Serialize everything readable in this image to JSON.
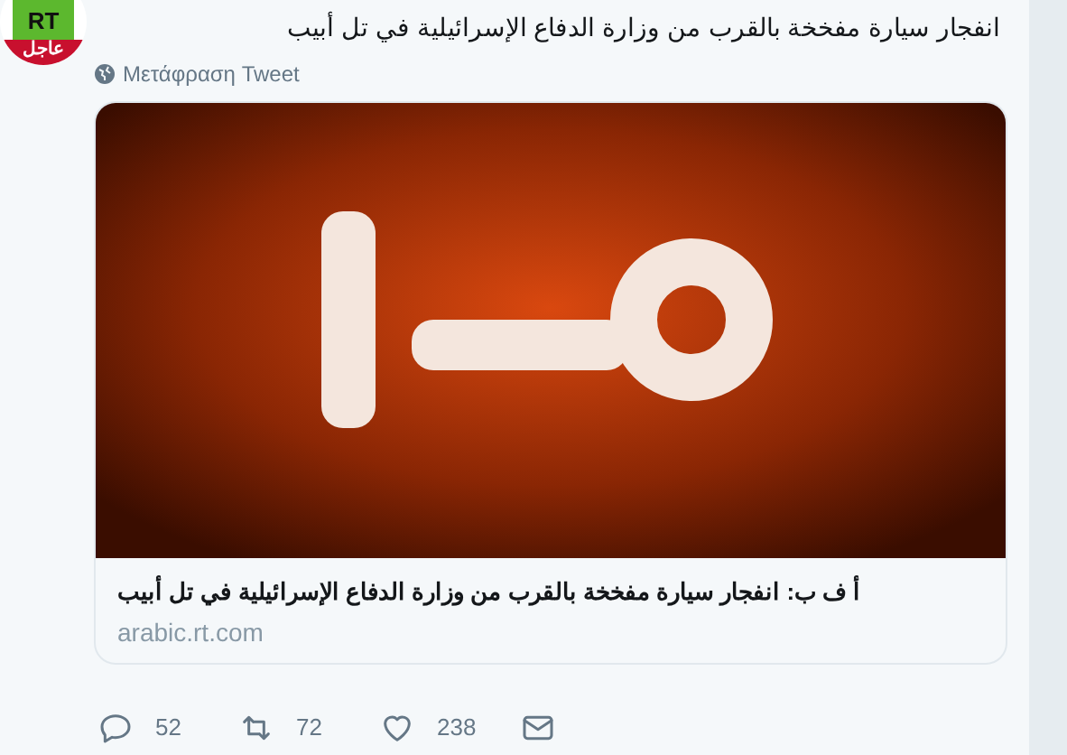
{
  "avatar": {
    "logo": "RT",
    "banner": "عاجل"
  },
  "tweet": {
    "text": "انفجار سيارة مفخخة بالقرب من وزارة الدفاع الإسرائيلية في تل أبيب",
    "translate": "Μετάφραση Tweet"
  },
  "card": {
    "title": "أ ف ب: انفجار سيارة مفخخة بالقرب من وزارة الدفاع الإسرائيلية في تل أبيب",
    "domain": "arabic.rt.com"
  },
  "actions": {
    "reply_count": "52",
    "retweet_count": "72",
    "like_count": "238"
  }
}
